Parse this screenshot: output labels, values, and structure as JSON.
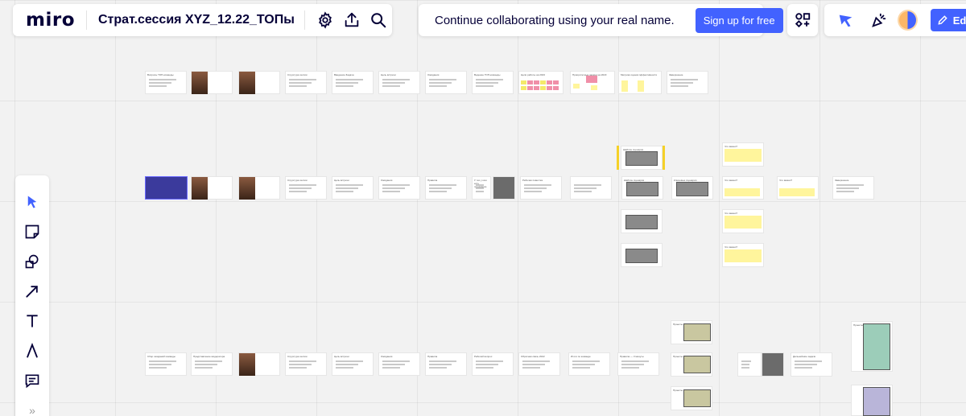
{
  "app": {
    "logo": "miro",
    "board_title": "Страт.сессия XYZ_12.22_ТОПы"
  },
  "top_bar": {
    "icons": [
      "settings-icon",
      "upload-icon",
      "search-icon"
    ]
  },
  "banner": {
    "text": "Continue collaborating using your real name.",
    "signup_label": "Sign up for free"
  },
  "right_bar": {
    "edit_label": "Edi",
    "accent_color": "#4262ff"
  },
  "left_toolbar": {
    "tools": [
      "select-cursor-icon",
      "sticky-note-icon",
      "shapes-icon",
      "arrow-connector-icon",
      "text-icon",
      "pen-icon",
      "comment-icon",
      "expand-more-icon"
    ],
    "more_label": "»"
  },
  "board": {
    "row1_labels": [
      "Вопросы ТОП-команды",
      "",
      "",
      "Структура сессии",
      "Введение Задача",
      "Цель встречи",
      "Ожидания",
      "Ведение ТОП-команды",
      "Цели работы на 2023",
      "Приоритетные задачи на 2023",
      "Метрики оценки эффективности",
      "Завершение"
    ],
    "row2_labels": [
      "",
      "",
      "",
      "Структура сессии",
      "Цель встречи",
      "Ожидания",
      "Правила",
      "У тех у кого есть понимание",
      "",
      "Рабочая повестка",
      "",
      "Шаблон сценария",
      "Ключевые сценарии",
      "Что важно?",
      "Что важно?",
      "Завершение"
    ],
    "row3_labels": [
      "Сбор ожиданий команды",
      "Представление модератора",
      "",
      "Структура сессии",
      "Цель встречи",
      "Ожидания",
      "Правила",
      "Рабочий вопрос",
      "Обратная связь 2022",
      "Итоги по команде",
      "Правила — 3 минуты",
      "Проекты",
      "",
      "Дальнейшие задачи",
      "Проекты"
    ]
  }
}
